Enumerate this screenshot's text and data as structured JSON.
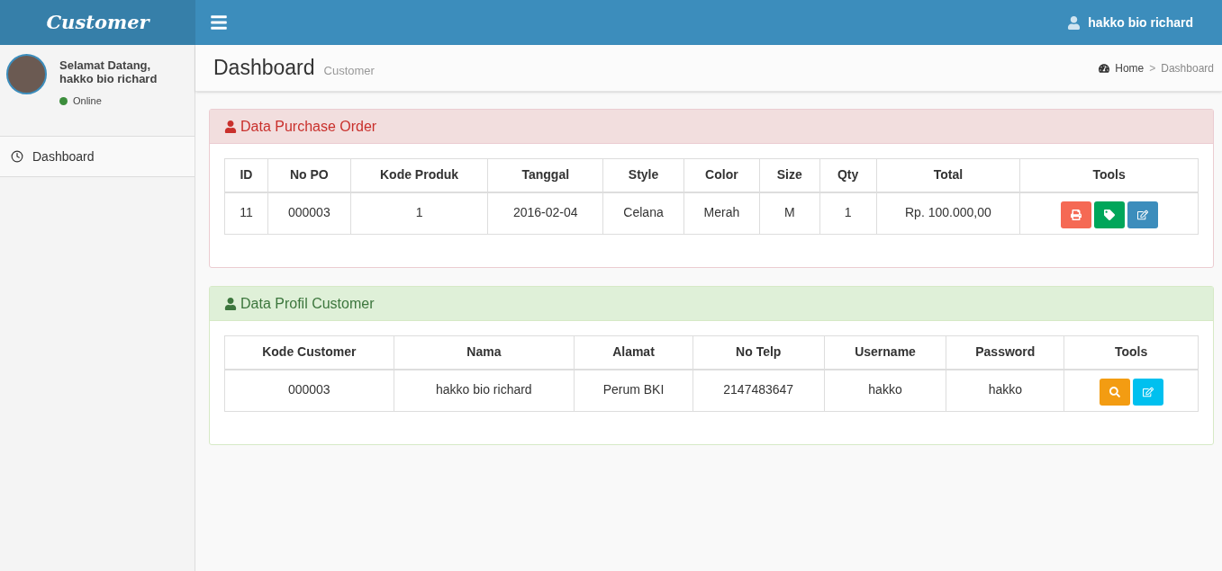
{
  "brand": "Customer",
  "topbar": {
    "user": "hakko bio richard"
  },
  "sidebar": {
    "greeting": "Selamat Datang,",
    "name": "hakko bio richard",
    "status": {
      "label": "Online",
      "color": "#3c8d3c"
    },
    "items": [
      {
        "label": "Dashboard",
        "selected": false
      }
    ]
  },
  "page": {
    "title": "Dashboard",
    "subtitle": "Customer",
    "breadcrumb": {
      "home": "Home",
      "separator": ">",
      "current": "Dashboard"
    }
  },
  "panels": [
    {
      "kind": "danger",
      "title": "Data Purchase Order",
      "columns": [
        "ID",
        "No PO",
        "Kode Produk",
        "Tanggal",
        "Style",
        "Color",
        "Size",
        "Qty",
        "Total",
        "Tools"
      ],
      "rows": [
        [
          "11",
          "000003",
          "1",
          "2016-02-04",
          "Celana",
          "Merah",
          "M",
          "1",
          "Rp. 100.000,00"
        ]
      ],
      "tools": [
        {
          "kind": "print",
          "color": "#f56954"
        },
        {
          "kind": "tag",
          "color": "#00a65a"
        },
        {
          "kind": "edit",
          "color": "#3c8dbc"
        }
      ]
    },
    {
      "kind": "success",
      "title": "Data Profil Customer",
      "columns": [
        "Kode Customer",
        "Nama",
        "Alamat",
        "No Telp",
        "Username",
        "Password",
        "Tools"
      ],
      "rows": [
        [
          "000003",
          "hakko bio richard",
          "Perum BKI",
          "2147483647",
          "hakko",
          "hakko"
        ]
      ],
      "tools": [
        {
          "kind": "search",
          "color": "#f39c12"
        },
        {
          "kind": "edit",
          "color": "#00c0ef"
        }
      ]
    }
  ]
}
